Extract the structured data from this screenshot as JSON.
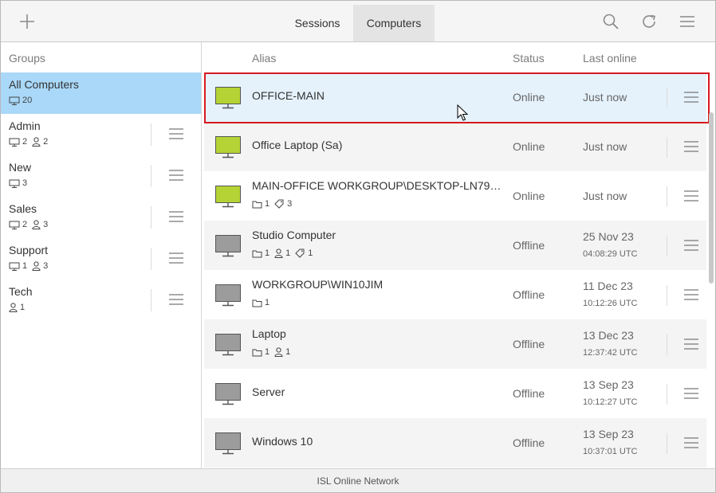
{
  "topbar": {
    "tabs": [
      {
        "label": "Sessions",
        "active": false
      },
      {
        "label": "Computers",
        "active": true
      }
    ],
    "icons": [
      "plus-icon",
      "search-icon",
      "refresh-icon",
      "menu-icon"
    ]
  },
  "sidebar": {
    "header": "Groups",
    "groups": [
      {
        "name": "All Computers",
        "computers": "20",
        "users": null,
        "selected": true
      },
      {
        "name": "Admin",
        "computers": "2",
        "users": "2"
      },
      {
        "name": "New",
        "computers": "3",
        "users": null
      },
      {
        "name": "Sales",
        "computers": "2",
        "users": "3"
      },
      {
        "name": "Support",
        "computers": "1",
        "users": "3"
      },
      {
        "name": "Tech",
        "computers": null,
        "users": "1"
      }
    ]
  },
  "list": {
    "columns": {
      "alias": "Alias",
      "status": "Status",
      "last_online": "Last online"
    },
    "rows": [
      {
        "alias": "OFFICE-MAIN",
        "status": "Online",
        "last": "Just now",
        "time": "",
        "online": true,
        "selected": true
      },
      {
        "alias": "Office Laptop (Sa)",
        "status": "Online",
        "last": "Just now",
        "time": "",
        "online": true
      },
      {
        "alias": "MAIN-OFFICE WORKGROUP\\DESKTOP-LN79…",
        "status": "Online",
        "last": "Just now",
        "time": "",
        "online": true,
        "folders": "1",
        "tags": "3"
      },
      {
        "alias": "Studio Computer",
        "status": "Offline",
        "last": "25 Nov 23",
        "time": "04:08:29 UTC",
        "online": false,
        "folders": "1",
        "users": "1",
        "tags": "1"
      },
      {
        "alias": "WORKGROUP\\WIN10JIM",
        "status": "Offline",
        "last": "11 Dec 23",
        "time": "10:12:26 UTC",
        "online": false,
        "folders": "1"
      },
      {
        "alias": "Laptop",
        "status": "Offline",
        "last": "13 Dec 23",
        "time": "12:37:42 UTC",
        "online": false,
        "folders": "1",
        "users": "1"
      },
      {
        "alias": "Server",
        "status": "Offline",
        "last": "13 Sep 23",
        "time": "10:12:27 UTC",
        "online": false
      },
      {
        "alias": "Windows 10",
        "status": "Offline",
        "last": "13 Sep 23",
        "time": "10:37:01 UTC",
        "online": false
      }
    ]
  },
  "statusbar": {
    "text": "ISL Online Network"
  },
  "colors": {
    "online": "#b5d334",
    "offline": "#9c9c9c",
    "selected_group": "#a9d8f8",
    "selected_row": "#e5f2fc",
    "highlight": "#d71920"
  }
}
